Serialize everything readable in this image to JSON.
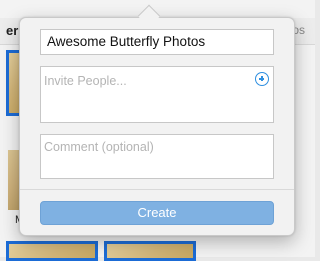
{
  "background": {
    "header_left_fragment": "er",
    "header_right_fragment": "os",
    "thumbnail_caption_fragment": "M"
  },
  "popover": {
    "album_name": {
      "value": "Awesome Butterfly Photos"
    },
    "invite": {
      "placeholder": "Invite People...",
      "add_icon": "plus-circle-icon"
    },
    "comment": {
      "placeholder": "Comment (optional)"
    },
    "create_button": {
      "label": "Create"
    }
  },
  "colors": {
    "accent": "#2f8fe0",
    "create_button_bg": "#7fb1e2",
    "selection_border": "#1c6cd6"
  }
}
